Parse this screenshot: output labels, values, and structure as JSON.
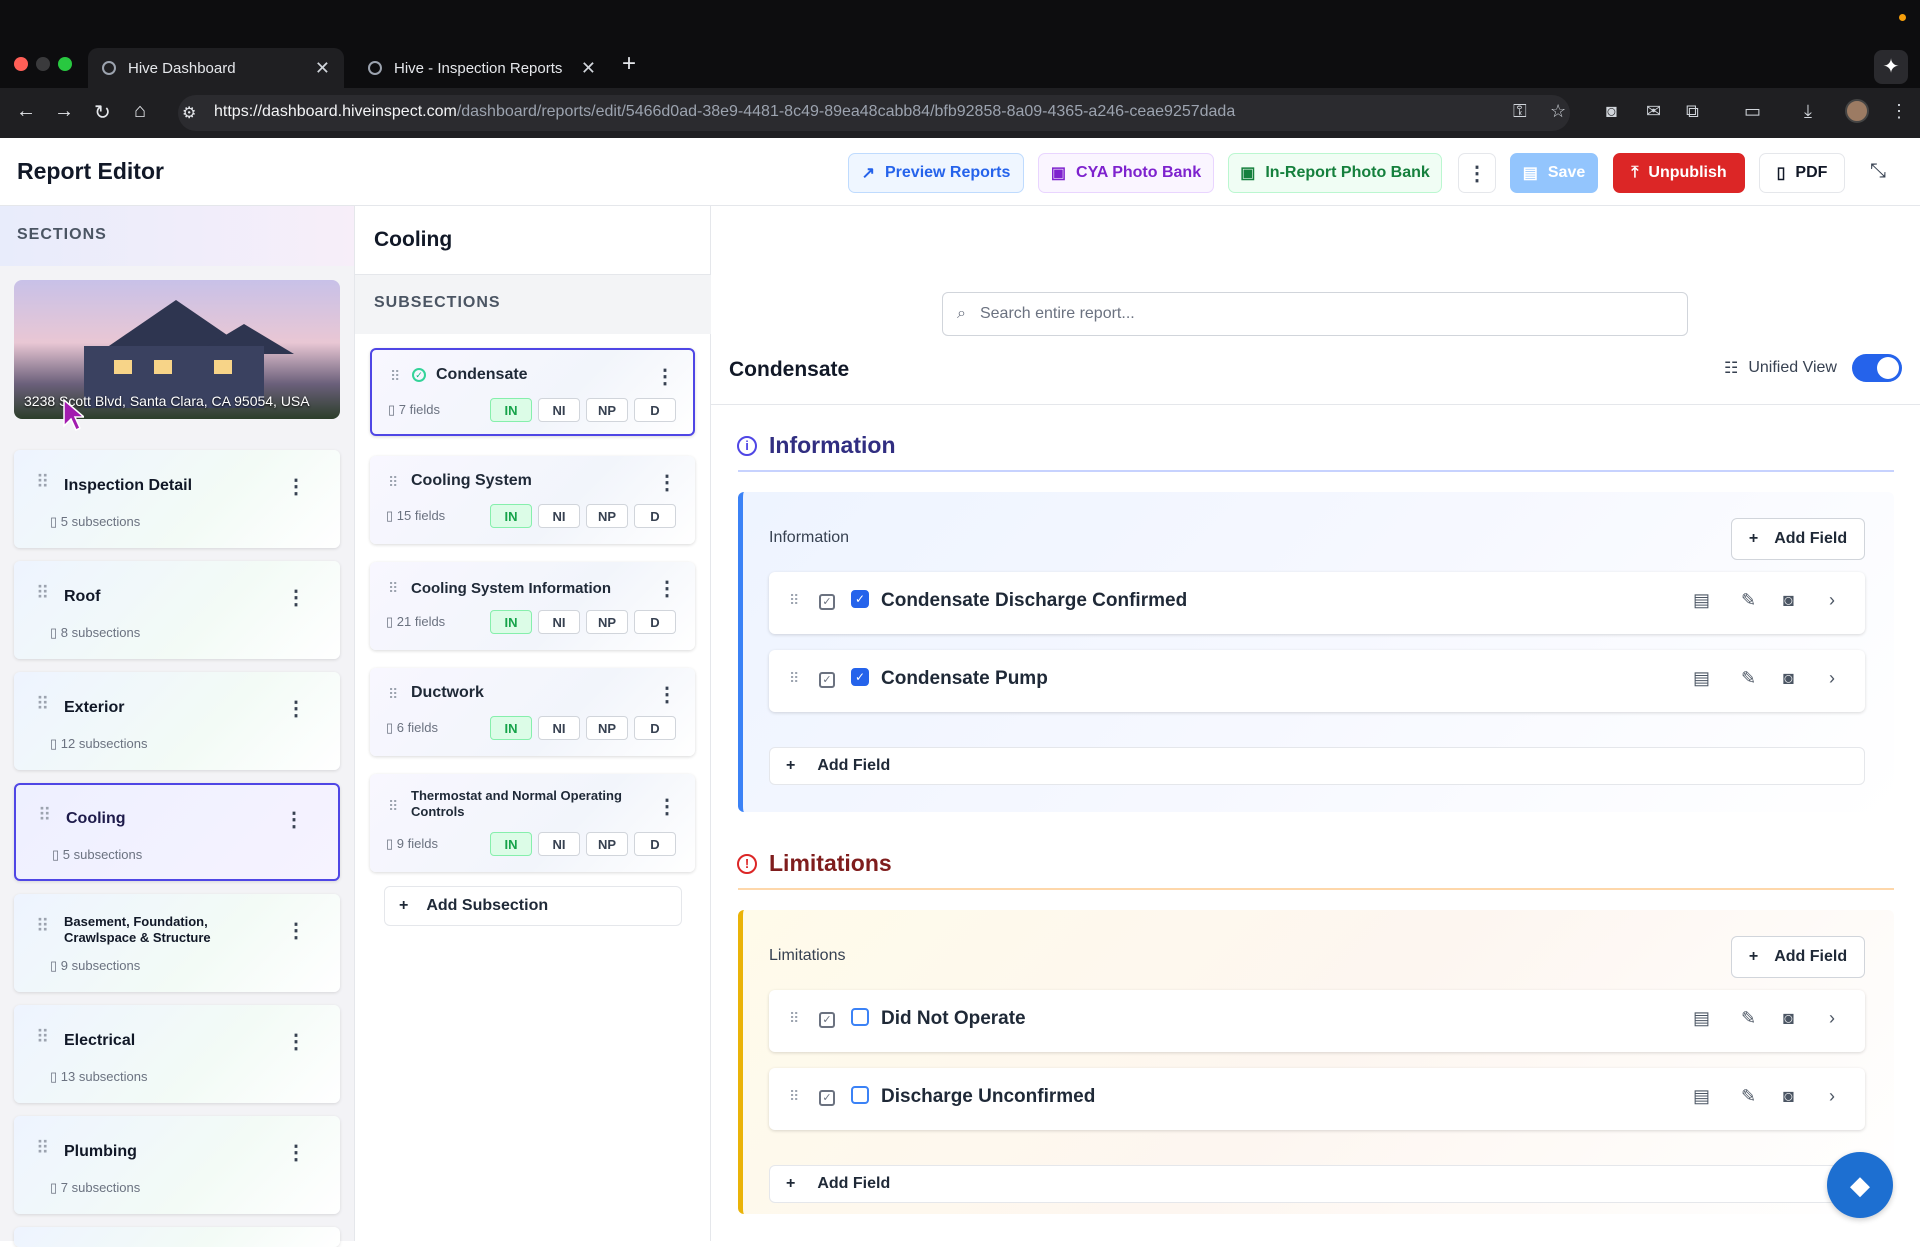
{
  "browser": {
    "tabs": [
      {
        "title": "Hive Dashboard",
        "active": true
      },
      {
        "title": "Hive - Inspection Reports",
        "active": false
      }
    ],
    "url_host": "https://dashboard.hiveinspect.com",
    "url_path": "/dashboard/reports/edit/5466d0ad-38e9-4481-8c49-89ea48cabb84/bfb92858-8a09-4365-a246-ceae9257dada"
  },
  "header": {
    "title": "Report Editor",
    "buttons": {
      "preview": "Preview Reports",
      "cya": "CYA Photo Bank",
      "inreport": "In-Report Photo Bank",
      "save": "Save",
      "unpublish": "Unpublish",
      "pdf": "PDF"
    },
    "colors": {
      "preview": "#2563eb",
      "cya": "#7e22ce",
      "inreport": "#15803d",
      "unpublish": "#dc2626",
      "save": "#93c5fd"
    }
  },
  "sections": {
    "label": "SECTIONS",
    "address": "3238 Scott Blvd, Santa Clara, CA 95054, USA",
    "items": [
      {
        "name": "Inspection Detail",
        "sub": "5 subsections"
      },
      {
        "name": "Roof",
        "sub": "8 subsections"
      },
      {
        "name": "Exterior",
        "sub": "12 subsections"
      },
      {
        "name": "Cooling",
        "sub": "5 subsections",
        "active": true
      },
      {
        "name": "Basement, Foundation, Crawlspace & Structure",
        "sub": "9 subsections"
      },
      {
        "name": "Electrical",
        "sub": "13 subsections"
      },
      {
        "name": "Plumbing",
        "sub": "7 subsections"
      }
    ]
  },
  "subsections": {
    "heading": "Cooling",
    "label": "SUBSECTIONS",
    "pills": [
      "IN",
      "NI",
      "NP",
      "D"
    ],
    "items": [
      {
        "name": "Condensate",
        "fields": "7 fields",
        "active": true
      },
      {
        "name": "Cooling System",
        "fields": "15 fields"
      },
      {
        "name": "Cooling System Information",
        "fields": "21 fields"
      },
      {
        "name": "Ductwork",
        "fields": "6 fields"
      },
      {
        "name": "Thermostat and Normal Operating Controls",
        "fields": "9 fields"
      }
    ],
    "add_label": "Add Subsection"
  },
  "main": {
    "search_placeholder": "Search entire report...",
    "title": "Condensate",
    "unified_view": "Unified View",
    "unified_on": true,
    "information": {
      "title": "Information",
      "label": "Information",
      "add_field": "Add Field",
      "fields": [
        {
          "name": "Condensate Discharge Confirmed",
          "checked": true
        },
        {
          "name": "Condensate Pump",
          "checked": true
        }
      ]
    },
    "limitations": {
      "title": "Limitations",
      "label": "Limitations",
      "add_field": "Add Field",
      "fields": [
        {
          "name": "Did Not Operate",
          "checked": false
        },
        {
          "name": "Discharge Unconfirmed",
          "checked": false
        }
      ]
    }
  }
}
